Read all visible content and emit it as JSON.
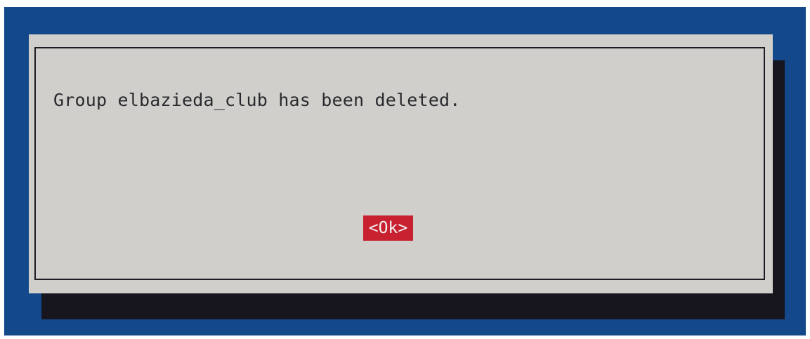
{
  "dialog": {
    "message": "Group elbazieda_club has been deleted.",
    "ok_label": "<Ok>"
  },
  "colors": {
    "background": "#13488a",
    "dialog": "#d0cfcc",
    "shadow": "#17161f",
    "button": "#c8212f",
    "button_text": "#f2f2f2",
    "text": "#2a2a2e"
  }
}
